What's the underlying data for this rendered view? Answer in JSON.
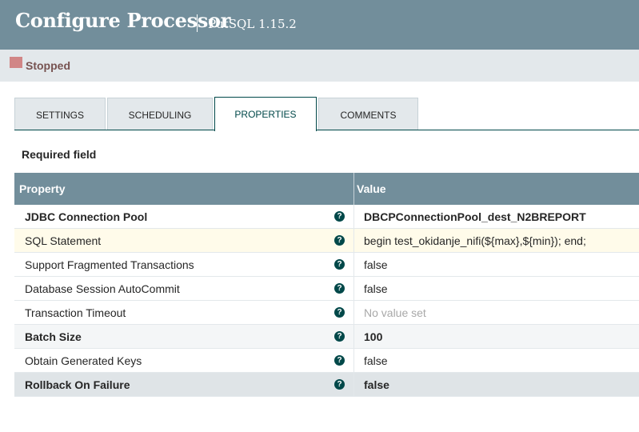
{
  "header": {
    "title": "Configure Processor",
    "subtitle": "PutSQL 1.15.2"
  },
  "status": {
    "label": "Stopped",
    "color": "#d18686"
  },
  "tabs": [
    {
      "label": "SETTINGS"
    },
    {
      "label": "SCHEDULING"
    },
    {
      "label": "PROPERTIES",
      "active": true
    },
    {
      "label": "COMMENTS"
    }
  ],
  "required_label": "Required field",
  "table": {
    "headers": {
      "property": "Property",
      "value": "Value"
    },
    "rows": [
      {
        "name": "JDBC Connection Pool",
        "value": "DBCPConnectionPool_dest_N2BREPORT",
        "required": true
      },
      {
        "name": "SQL Statement",
        "value": "begin test_okidanje_nifi(${max},${min}); end;",
        "required": false
      },
      {
        "name": "Support Fragmented Transactions",
        "value": "false",
        "required": false
      },
      {
        "name": "Database Session AutoCommit",
        "value": "false",
        "required": false
      },
      {
        "name": "Transaction Timeout",
        "value": "No value set",
        "required": false
      },
      {
        "name": "Batch Size",
        "value": "100",
        "required": true
      },
      {
        "name": "Obtain Generated Keys",
        "value": "false",
        "required": false
      },
      {
        "name": "Rollback On Failure",
        "value": "false",
        "required": true
      }
    ],
    "help_glyph": "?"
  },
  "colors": {
    "header": "#728e9b",
    "accent": "#004849",
    "status": "#d18686"
  }
}
